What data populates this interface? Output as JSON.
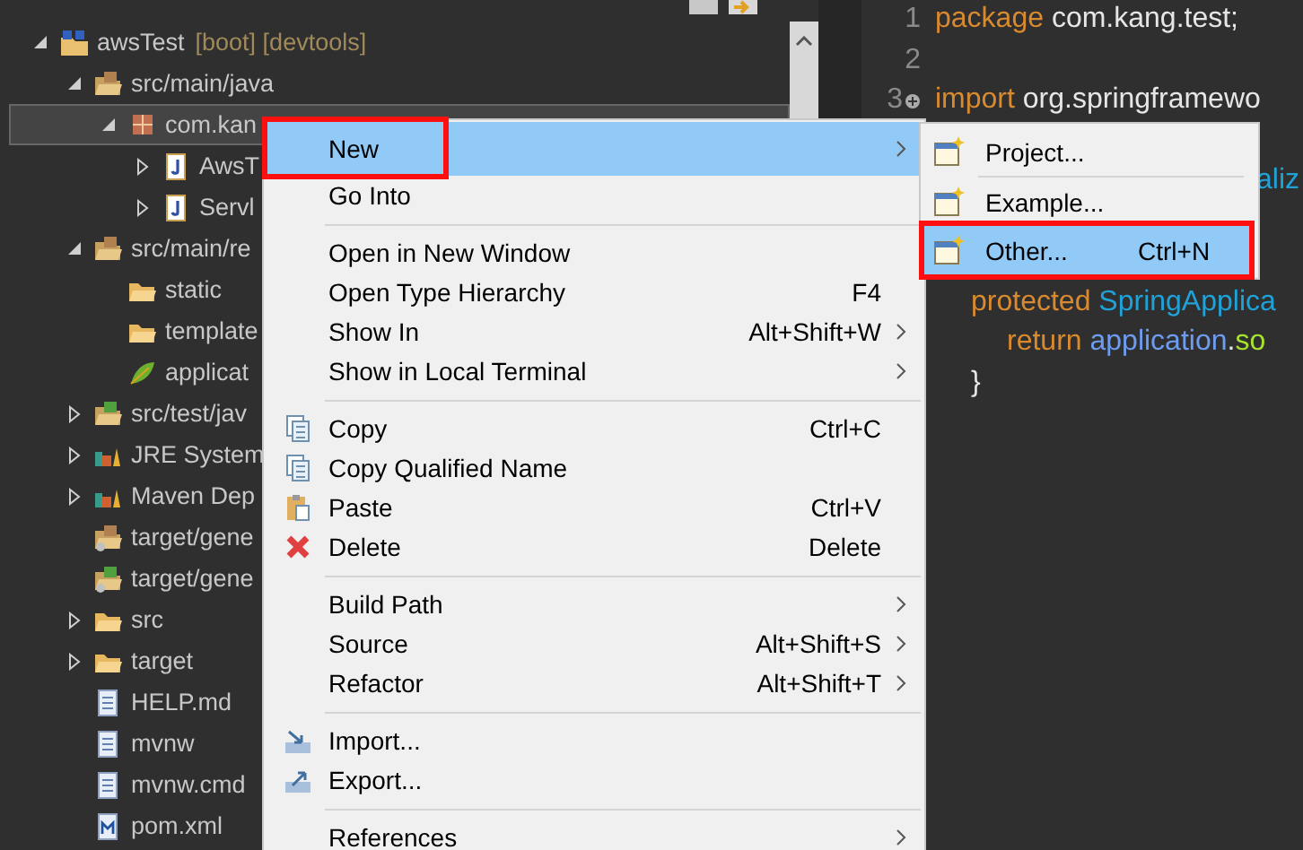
{
  "explorer": {
    "items": [
      {
        "kind": "project",
        "label": "awsTest",
        "decoration": "[boot] [devtools]",
        "expanded": true,
        "selected": false,
        "children": [
          {
            "kind": "source-folder",
            "label": "src/main/java",
            "expanded": true,
            "selected": false,
            "children": [
              {
                "kind": "package",
                "label": "com.kan",
                "expanded": true,
                "selected": true,
                "children": [
                  {
                    "kind": "java-file",
                    "label": "AwsT",
                    "expanded": false,
                    "selected": false
                  },
                  {
                    "kind": "java-file",
                    "label": "Servl",
                    "expanded": false,
                    "selected": false
                  }
                ]
              }
            ]
          },
          {
            "kind": "source-folder",
            "label": "src/main/re",
            "expanded": true,
            "selected": false,
            "children": [
              {
                "kind": "folder",
                "label": "static",
                "selected": false
              },
              {
                "kind": "folder",
                "label": "template",
                "selected": false
              },
              {
                "kind": "yaml-file",
                "label": "applicat",
                "selected": false
              }
            ]
          },
          {
            "kind": "test-folder",
            "label": "src/test/jav",
            "expanded": false,
            "selected": false
          },
          {
            "kind": "library",
            "label": "JRE System",
            "expanded": false,
            "selected": false
          },
          {
            "kind": "library",
            "label": "Maven Dep",
            "expanded": false,
            "selected": false
          },
          {
            "kind": "generated-folder",
            "label": "target/gene",
            "selected": false
          },
          {
            "kind": "generated-test-folder",
            "label": "target/gene",
            "selected": false
          },
          {
            "kind": "folder",
            "label": "src",
            "expanded": false,
            "selected": false
          },
          {
            "kind": "folder",
            "label": "target",
            "expanded": false,
            "selected": false
          },
          {
            "kind": "text-file",
            "label": "HELP.md",
            "selected": false
          },
          {
            "kind": "text-file",
            "label": "mvnw",
            "selected": false
          },
          {
            "kind": "text-file",
            "label": "mvnw.cmd",
            "selected": false
          },
          {
            "kind": "maven-file",
            "label": "pom.xml",
            "selected": false
          }
        ]
      }
    ]
  },
  "editor": {
    "lines": [
      {
        "number": "1",
        "tokens": [
          {
            "kind": "keyword",
            "text": "package"
          },
          {
            "kind": "plain",
            "text": " com.kang.test;"
          }
        ]
      },
      {
        "number": "2",
        "kind": "blank"
      },
      {
        "number": "3",
        "folded": true,
        "tokens": [
          {
            "kind": "keyword",
            "text": "import"
          },
          {
            "kind": "plain",
            "text": " org.springframewo"
          }
        ]
      },
      {
        "kind": "blank"
      },
      {
        "kind": "clipped",
        "tokens": [
          {
            "kind": "type",
            "text": "aliz"
          }
        ]
      },
      {
        "kind": "blank"
      },
      {
        "kind": "blank"
      },
      {
        "kind": "member",
        "tokens": [
          {
            "kind": "keyword",
            "text": "protected"
          },
          {
            "kind": "type",
            "text": " SpringApplica"
          }
        ]
      },
      {
        "kind": "statement",
        "tokens": [
          {
            "kind": "keyword",
            "text": "return"
          },
          {
            "kind": "field",
            "text": " application"
          },
          {
            "kind": "plain",
            "text": "."
          },
          {
            "kind": "method",
            "text": "so"
          }
        ]
      },
      {
        "kind": "member",
        "tokens": [
          {
            "kind": "plain",
            "text": "}"
          }
        ]
      }
    ]
  },
  "context_menu": {
    "items": [
      {
        "kind": "plain",
        "label": "New",
        "has_submenu": true,
        "selected": true,
        "annotated": true
      },
      {
        "kind": "plain",
        "label": "Go Into",
        "has_submenu": false,
        "selected": false,
        "annotated": false
      },
      {
        "kind": "separator"
      },
      {
        "kind": "plain",
        "label": "Open in New Window",
        "has_submenu": false,
        "selected": false,
        "annotated": false
      },
      {
        "kind": "plain",
        "label": "Open Type Hierarchy",
        "shortcut": "F4",
        "has_submenu": false,
        "selected": false,
        "annotated": false
      },
      {
        "kind": "plain",
        "label": "Show In",
        "shortcut": "Alt+Shift+W",
        "has_submenu": true,
        "selected": false,
        "annotated": false
      },
      {
        "kind": "plain",
        "label": "Show in Local Terminal",
        "has_submenu": true,
        "selected": false,
        "annotated": false
      },
      {
        "kind": "separator"
      },
      {
        "kind": "copy",
        "label": "Copy",
        "shortcut": "Ctrl+C",
        "has_submenu": false,
        "selected": false,
        "annotated": false
      },
      {
        "kind": "copy-name",
        "label": "Copy Qualified Name",
        "has_submenu": false,
        "selected": false,
        "annotated": false
      },
      {
        "kind": "paste",
        "label": "Paste",
        "shortcut": "Ctrl+V",
        "has_submenu": false,
        "selected": false,
        "annotated": false
      },
      {
        "kind": "delete",
        "label": "Delete",
        "shortcut": "Delete",
        "has_submenu": false,
        "selected": false,
        "annotated": false
      },
      {
        "kind": "separator"
      },
      {
        "kind": "plain",
        "label": "Build Path",
        "has_submenu": true,
        "selected": false,
        "annotated": false
      },
      {
        "kind": "plain",
        "label": "Source",
        "shortcut": "Alt+Shift+S",
        "has_submenu": true,
        "selected": false,
        "annotated": false
      },
      {
        "kind": "plain",
        "label": "Refactor",
        "shortcut": "Alt+Shift+T",
        "has_submenu": true,
        "selected": false,
        "annotated": false
      },
      {
        "kind": "separator"
      },
      {
        "kind": "import",
        "label": "Import...",
        "has_submenu": false,
        "selected": false,
        "annotated": false
      },
      {
        "kind": "export",
        "label": "Export...",
        "has_submenu": false,
        "selected": false,
        "annotated": false
      },
      {
        "kind": "separator"
      },
      {
        "kind": "plain",
        "label": "References",
        "has_submenu": true,
        "selected": false,
        "annotated": false
      }
    ]
  },
  "submenu": {
    "items": [
      {
        "kind": "wizard",
        "label": "Project...",
        "selected": false,
        "annotated": false
      },
      {
        "kind": "separator"
      },
      {
        "kind": "wizard",
        "label": "Example...",
        "selected": false,
        "annotated": false
      },
      {
        "kind": "wizard",
        "label": "Other...",
        "shortcut": "Ctrl+N",
        "selected": true,
        "annotated": true
      }
    ]
  }
}
